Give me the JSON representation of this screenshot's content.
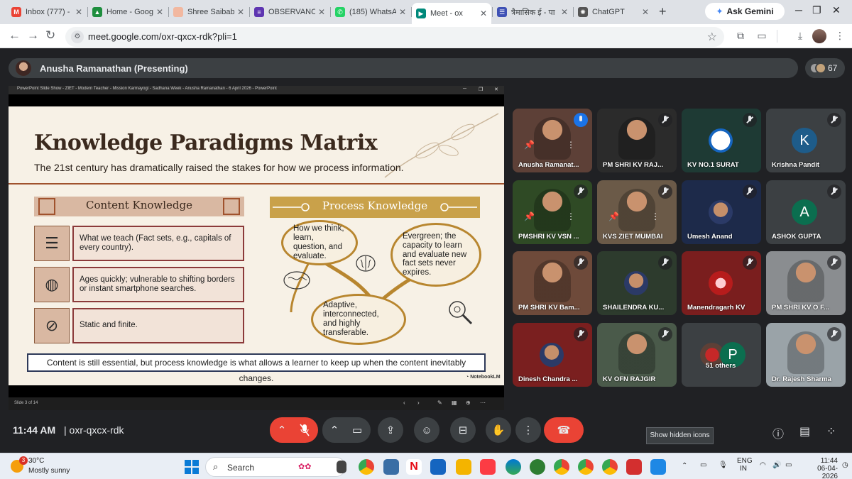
{
  "browser": {
    "tabs": [
      {
        "title": "Inbox (777) - r",
        "fav_color": "#ea4335",
        "fav_glyph": "M",
        "active": false
      },
      {
        "title": "Home - Goog",
        "fav_color": "#1e8e3e",
        "fav_glyph": "▲",
        "active": false
      },
      {
        "title": "Shree Saibaba",
        "fav_color": "#f2b8a0",
        "fav_glyph": "",
        "active": false
      },
      {
        "title": "OBSERVANCE",
        "fav_color": "#5e35b1",
        "fav_glyph": "≡",
        "active": false
      },
      {
        "title": "(185) WhatsAp",
        "fav_color": "#25d366",
        "fav_glyph": "✆",
        "active": false
      },
      {
        "title": "Meet - ox",
        "fav_color": "#00897b",
        "fav_glyph": "▶",
        "active": true
      },
      {
        "title": "त्रैमासिक ई - पा",
        "fav_color": "#3f51b5",
        "fav_glyph": "☰",
        "active": false
      },
      {
        "title": "ChatGPT",
        "fav_color": "#555555",
        "fav_glyph": "✺",
        "active": false
      }
    ],
    "ask_gemini": "Ask Gemini",
    "url": "meet.google.com/oxr-qxcx-rdk?pli=1"
  },
  "meet": {
    "presenter_label": "Anusha Ramanathan (Presenting)",
    "participant_count": "67",
    "presentation": {
      "window_title": "PowerPoint Slide Show - ZIET - Modern Teacher - Mission Karmayogi - Sadhana Week - Anusha Ramanathan - 6 April 2026 - PowerPoint",
      "slide_counter": "Slide 3 of 14",
      "slide": {
        "title": "Knowledge Paradigms Matrix",
        "subtitle": "The 21st century has dramatically raised the stakes for how we process information.",
        "content_heading": "Content Knowledge",
        "process_heading": "Process Knowledge",
        "content_rows": [
          {
            "icon": "books-icon",
            "text": "What we teach (Fact sets, e.g., capitals of every country)."
          },
          {
            "icon": "globe-icon",
            "text": "Ages quickly; vulnerable to shifting borders or instant smartphone searches."
          },
          {
            "icon": "globe-blocked-icon",
            "text": "Static and finite."
          }
        ],
        "process_bubbles": [
          "How we think, learn, question, and evaluate.",
          "Evergreen; the capacity to learn and evaluate new fact sets never expires.",
          "Adaptive, interconnected, and highly transferable."
        ],
        "bottom_note": "Content is still essential, but process knowledge is what allows a learner to keep up when the content inevitably changes.",
        "brand": "NotebookLM"
      }
    },
    "participants": [
      {
        "name": "Anusha Ramanat...",
        "bg": "#5d4037",
        "talking": true
      },
      {
        "name": "PM SHRI KV RAJ...",
        "bg": "#2b2b2b",
        "talking": false
      },
      {
        "name": "KV NO.1 SURAT",
        "bg": "#1e3a34",
        "letter": "",
        "talking": false
      },
      {
        "name": "Krishna Pandit",
        "bg": "#3c4043",
        "letter": "K",
        "letter_bg": "#1e5c8a",
        "talking": false
      },
      {
        "name": "PMSHRI KV VSN ...",
        "bg": "#2f4a25",
        "talking": false
      },
      {
        "name": "KVS ZIET MUMBAI",
        "bg": "#6b5a48",
        "talking": false
      },
      {
        "name": "Umesh Anand",
        "bg": "#1d2a4a",
        "talking": false
      },
      {
        "name": "ASHOK GUPTA",
        "bg": "#3c4043",
        "letter": "A",
        "letter_bg": "#0b6e4f",
        "talking": false
      },
      {
        "name": "PM SHRI KV Bam...",
        "bg": "#6e4a3a",
        "talking": false
      },
      {
        "name": "SHAILENDRA KU...",
        "bg": "#2d3b2d",
        "talking": false
      },
      {
        "name": "Manendragarh KV",
        "bg": "#7a1e1e",
        "talking": false
      },
      {
        "name": "PM SHRI KV O F...",
        "bg": "#8a8d90",
        "talking": false
      },
      {
        "name": "Dinesh Chandra ...",
        "bg": "#7a1f1f",
        "talking": false
      },
      {
        "name": "KV OFN RAJGIR",
        "bg": "#4a5a4a",
        "talking": false
      },
      {
        "name": "51 others",
        "bg": "#3c4043",
        "letter": "P",
        "letter_bg": "#0b6e4f",
        "talking": false
      },
      {
        "name": "Dr. Rajesh Sharma",
        "bg": "#9aa3a8",
        "talking": false
      }
    ],
    "time": "11:44 AM",
    "meeting_code": "oxr-qxcx-rdk",
    "tooltip": "Show hidden icons"
  },
  "taskbar": {
    "temperature": "30°C",
    "condition": "Mostly sunny",
    "weather_badge": "3",
    "search_placeholder": "Search",
    "language": "ENG",
    "region": "IN",
    "time": "11:44",
    "date": "06-04-2026"
  }
}
